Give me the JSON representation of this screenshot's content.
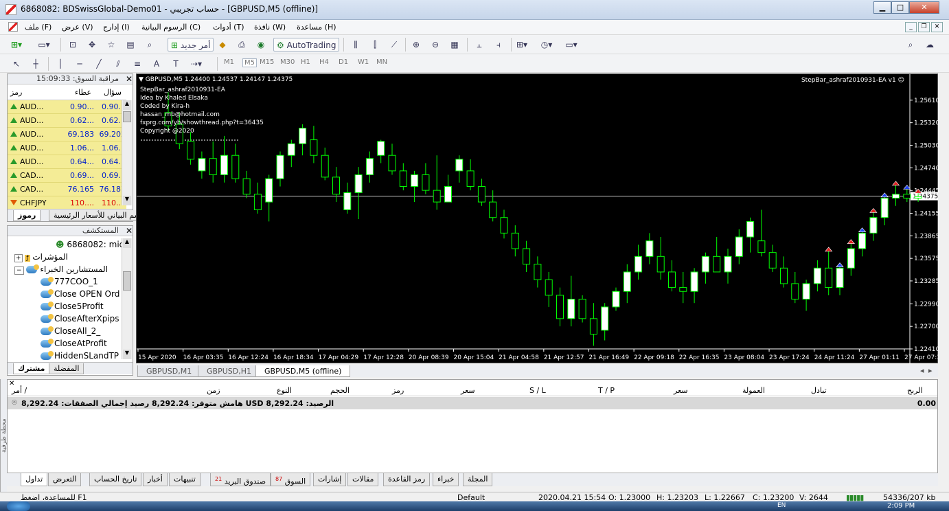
{
  "window": {
    "title": "6868082: BDSwissGlobal-Demo01 - حساب تجريبي - [GBPUSD,M5 (offline)]",
    "min": "▁",
    "max": "□",
    "close": "✕"
  },
  "menu": {
    "items": [
      "ملف (F)",
      "عرض (V)",
      "إدارج (I)",
      "الرسوم البيانية (C)",
      "أدوات (T)",
      "نافذة (W)",
      "مساعدة (H)"
    ]
  },
  "toolbar": {
    "new_order": "أمر جديد",
    "autotrading": "AutoTrading",
    "timeframes": [
      "M1",
      "M5",
      "M15",
      "M30",
      "H1",
      "H4",
      "D1",
      "W1",
      "MN"
    ],
    "text_tool": "A"
  },
  "market_watch": {
    "title": "مراقبة السوق: 15:09:33",
    "col_symbol": "رمز",
    "col_bid": "عطاء",
    "col_ask": "سؤال",
    "rows": [
      {
        "symbol": "AUD...",
        "bid": "0.90...",
        "ask": "0.90...",
        "dir": "up"
      },
      {
        "symbol": "AUD...",
        "bid": "0.62...",
        "ask": "0.62...",
        "dir": "up"
      },
      {
        "symbol": "AUD...",
        "bid": "69.183",
        "ask": "69.202",
        "dir": "up"
      },
      {
        "symbol": "AUD...",
        "bid": "1.06...",
        "ask": "1.06...",
        "dir": "up"
      },
      {
        "symbol": "AUD...",
        "bid": "0.64...",
        "ask": "0.64...",
        "dir": "up"
      },
      {
        "symbol": "CAD...",
        "bid": "0.69...",
        "ask": "0.69...",
        "dir": "up"
      },
      {
        "symbol": "CAD...",
        "bid": "76.165",
        "ask": "76.187",
        "dir": "up"
      },
      {
        "symbol": "CHFJPY",
        "bid": "110....",
        "ask": "110....",
        "dir": "down"
      }
    ],
    "tab_symbols": "رموز",
    "tab_chart": "رسم البياني للأسعار الرئيسية"
  },
  "navigator": {
    "title": "المستكشف",
    "account": "6868082: mido",
    "indicators": "المؤشرات",
    "experts": "المستشارين الخبراء",
    "items": [
      "777COO_1",
      "Close OPEN Orde",
      "Close5Profit",
      "CloseAfterXpips E",
      "CloseAll_2_",
      "CloseAtProfit",
      "HiddenSLandTP"
    ],
    "tab_common": "مشترك",
    "tab_favorites": "المفضلة"
  },
  "chart": {
    "header": "GBPUSD,M5  1.24400 1.24537 1.24147 1.24375",
    "ea_label": "StepBar_ashraf2010931-EA v1",
    "info_lines": [
      "StepBar_ashraf2010931-EA",
      "Idea by Khaled Elsaka",
      "Coded by Kira-h",
      "hassan_mb@hotmail.com",
      "fxprg.com/yb/showthread.php?t=36435",
      "Copyright @2020"
    ],
    "current_price": "1.24375",
    "price_labels": [
      "1.25610",
      "1.25320",
      "1.25030",
      "1.24740",
      "1.24445",
      "1.24155",
      "1.23865",
      "1.23575",
      "1.23285",
      "1.22990",
      "1.22700",
      "1.22410"
    ],
    "time_labels": [
      "15 Apr 2020",
      "16 Apr 03:35",
      "16 Apr 12:24",
      "16 Apr 18:34",
      "17 Apr 04:29",
      "17 Apr 12:28",
      "20 Apr 08:39",
      "20 Apr 15:04",
      "21 Apr 04:58",
      "21 Apr 12:57",
      "21 Apr 16:49",
      "22 Apr 09:18",
      "22 Apr 16:35",
      "23 Apr 08:04",
      "23 Apr 17:24",
      "24 Apr 11:24",
      "27 Apr 01:11",
      "27 Apr 07:35"
    ],
    "colors": {
      "bg": "#000000",
      "bull_body": "#ffffff",
      "bear_body": "#000000",
      "wick": "#00ff00",
      "text": "#ffffff"
    }
  },
  "chart_data": {
    "type": "candlestick",
    "symbol": "GBPUSD",
    "timeframe": "M5",
    "ylim": [
      1.2241,
      1.2575
    ],
    "candles": [
      {
        "o": 1.2545,
        "h": 1.2571,
        "l": 1.2522,
        "c": 1.2528
      },
      {
        "o": 1.253,
        "h": 1.2545,
        "l": 1.2498,
        "c": 1.2505
      },
      {
        "o": 1.2508,
        "h": 1.252,
        "l": 1.2478,
        "c": 1.2485
      },
      {
        "o": 1.247,
        "h": 1.2495,
        "l": 1.246,
        "c": 1.2486
      },
      {
        "o": 1.2486,
        "h": 1.2508,
        "l": 1.2455,
        "c": 1.2465
      },
      {
        "o": 1.2465,
        "h": 1.2515,
        "l": 1.2455,
        "c": 1.249
      },
      {
        "o": 1.249,
        "h": 1.2505,
        "l": 1.2455,
        "c": 1.246
      },
      {
        "o": 1.246,
        "h": 1.247,
        "l": 1.2435,
        "c": 1.244
      },
      {
        "o": 1.244,
        "h": 1.2455,
        "l": 1.2415,
        "c": 1.242
      },
      {
        "o": 1.243,
        "h": 1.2465,
        "l": 1.2405,
        "c": 1.246
      },
      {
        "o": 1.246,
        "h": 1.2495,
        "l": 1.245,
        "c": 1.249
      },
      {
        "o": 1.249,
        "h": 1.251,
        "l": 1.2475,
        "c": 1.2505
      },
      {
        "o": 1.2505,
        "h": 1.253,
        "l": 1.249,
        "c": 1.2525
      },
      {
        "o": 1.251,
        "h": 1.2528,
        "l": 1.248,
        "c": 1.249
      },
      {
        "o": 1.249,
        "h": 1.25,
        "l": 1.2458,
        "c": 1.2462
      },
      {
        "o": 1.2462,
        "h": 1.2475,
        "l": 1.243,
        "c": 1.244
      },
      {
        "o": 1.242,
        "h": 1.2455,
        "l": 1.2415,
        "c": 1.2442
      },
      {
        "o": 1.2442,
        "h": 1.2475,
        "l": 1.2408,
        "c": 1.2465
      },
      {
        "o": 1.2465,
        "h": 1.2495,
        "l": 1.2455,
        "c": 1.2486
      },
      {
        "o": 1.249,
        "h": 1.251,
        "l": 1.248,
        "c": 1.2508
      },
      {
        "o": 1.249,
        "h": 1.2505,
        "l": 1.2465,
        "c": 1.247
      },
      {
        "o": 1.247,
        "h": 1.248,
        "l": 1.2445,
        "c": 1.245
      },
      {
        "o": 1.245,
        "h": 1.247,
        "l": 1.243,
        "c": 1.2465
      },
      {
        "o": 1.2465,
        "h": 1.248,
        "l": 1.244,
        "c": 1.2445
      },
      {
        "o": 1.2445,
        "h": 1.249,
        "l": 1.242,
        "c": 1.243
      },
      {
        "o": 1.243,
        "h": 1.2465,
        "l": 1.244,
        "c": 1.245
      },
      {
        "o": 1.247,
        "h": 1.249,
        "l": 1.2455,
        "c": 1.2485
      },
      {
        "o": 1.247,
        "h": 1.2485,
        "l": 1.2445,
        "c": 1.245
      },
      {
        "o": 1.245,
        "h": 1.246,
        "l": 1.2425,
        "c": 1.243
      },
      {
        "o": 1.243,
        "h": 1.2445,
        "l": 1.2405,
        "c": 1.241
      },
      {
        "o": 1.241,
        "h": 1.242,
        "l": 1.2383,
        "c": 1.239
      },
      {
        "o": 1.239,
        "h": 1.24,
        "l": 1.236,
        "c": 1.237
      },
      {
        "o": 1.237,
        "h": 1.238,
        "l": 1.234,
        "c": 1.235
      },
      {
        "o": 1.235,
        "h": 1.236,
        "l": 1.232,
        "c": 1.233
      },
      {
        "o": 1.233,
        "h": 1.234,
        "l": 1.2295,
        "c": 1.231
      },
      {
        "o": 1.231,
        "h": 1.232,
        "l": 1.227,
        "c": 1.228
      },
      {
        "o": 1.228,
        "h": 1.2335,
        "l": 1.227,
        "c": 1.2305
      },
      {
        "o": 1.2305,
        "h": 1.231,
        "l": 1.2275,
        "c": 1.228
      },
      {
        "o": 1.228,
        "h": 1.23,
        "l": 1.2245,
        "c": 1.226
      },
      {
        "o": 1.2265,
        "h": 1.23,
        "l": 1.2252,
        "c": 1.2295
      },
      {
        "o": 1.2295,
        "h": 1.232,
        "l": 1.229,
        "c": 1.2315
      },
      {
        "o": 1.2315,
        "h": 1.235,
        "l": 1.23,
        "c": 1.234
      },
      {
        "o": 1.234,
        "h": 1.2375,
        "l": 1.233,
        "c": 1.236
      },
      {
        "o": 1.236,
        "h": 1.239,
        "l": 1.235,
        "c": 1.238
      },
      {
        "o": 1.236,
        "h": 1.2385,
        "l": 1.233,
        "c": 1.234
      },
      {
        "o": 1.234,
        "h": 1.2355,
        "l": 1.2315,
        "c": 1.232
      },
      {
        "o": 1.232,
        "h": 1.234,
        "l": 1.23,
        "c": 1.2315
      },
      {
        "o": 1.2315,
        "h": 1.2345,
        "l": 1.23,
        "c": 1.234
      },
      {
        "o": 1.234,
        "h": 1.2365,
        "l": 1.2325,
        "c": 1.236
      },
      {
        "o": 1.236,
        "h": 1.2385,
        "l": 1.235,
        "c": 1.234
      },
      {
        "o": 1.234,
        "h": 1.237,
        "l": 1.2325,
        "c": 1.236
      },
      {
        "o": 1.236,
        "h": 1.2395,
        "l": 1.235,
        "c": 1.2385
      },
      {
        "o": 1.2385,
        "h": 1.241,
        "l": 1.2365,
        "c": 1.2405
      },
      {
        "o": 1.238,
        "h": 1.242,
        "l": 1.236,
        "c": 1.2365
      },
      {
        "o": 1.2365,
        "h": 1.2375,
        "l": 1.234,
        "c": 1.2345
      },
      {
        "o": 1.2345,
        "h": 1.236,
        "l": 1.232,
        "c": 1.2325
      },
      {
        "o": 1.2325,
        "h": 1.234,
        "l": 1.23,
        "c": 1.2305
      },
      {
        "o": 1.2305,
        "h": 1.233,
        "l": 1.229,
        "c": 1.2325
      },
      {
        "o": 1.2325,
        "h": 1.2355,
        "l": 1.2315,
        "c": 1.2345
      },
      {
        "o": 1.2345,
        "h": 1.237,
        "l": 1.231,
        "c": 1.232
      },
      {
        "o": 1.232,
        "h": 1.235,
        "l": 1.231,
        "c": 1.2345
      },
      {
        "o": 1.2345,
        "h": 1.238,
        "l": 1.2335,
        "c": 1.237
      },
      {
        "o": 1.237,
        "h": 1.2395,
        "l": 1.236,
        "c": 1.239
      },
      {
        "o": 1.239,
        "h": 1.242,
        "l": 1.238,
        "c": 1.241
      },
      {
        "o": 1.241,
        "h": 1.244,
        "l": 1.24,
        "c": 1.2435
      },
      {
        "o": 1.2435,
        "h": 1.2455,
        "l": 1.2425,
        "c": 1.244
      },
      {
        "o": 1.244,
        "h": 1.245,
        "l": 1.243,
        "c": 1.2435
      },
      {
        "o": 1.2435,
        "h": 1.2445,
        "l": 1.243,
        "c": 1.2437
      }
    ]
  },
  "chart_tabs": [
    "GBPUSD,M1",
    "GBPUSD,H1",
    "GBPUSD,M5 (offline)"
  ],
  "terminal": {
    "columns": [
      "أمر /",
      "زمن",
      "النوع",
      "الحجم",
      "رمز",
      "سعر",
      "S / L",
      "T / P",
      "سعر",
      "العمولة",
      "تبادل",
      "الربح"
    ],
    "balance_text": "الرصيد: 8,292.24 USD  هامش متوفر: 8,292.24  رصيد إجمالي الصفقات: 8,292.24",
    "profit": "0.00",
    "side_label": "محطة طرفية",
    "tabs": [
      {
        "label": "تداول",
        "badge": ""
      },
      {
        "label": "التعرض",
        "badge": ""
      },
      {
        "label": "تاريخ الحساب",
        "badge": ""
      },
      {
        "label": "أخبار",
        "badge": ""
      },
      {
        "label": "تنبيهات",
        "badge": ""
      },
      {
        "label": "صندوق البريد",
        "badge": "21"
      },
      {
        "label": "السوق",
        "badge": "87"
      },
      {
        "label": "إشارات",
        "badge": ""
      },
      {
        "label": "مقالات",
        "badge": ""
      },
      {
        "label": "رمز القاعدة",
        "badge": ""
      },
      {
        "label": "خبراء",
        "badge": ""
      },
      {
        "label": "المجلة",
        "badge": ""
      }
    ]
  },
  "status": {
    "help": "للمساعدة، اضغط F1",
    "profile": "Default",
    "datetime": "2020.04.21 15:54",
    "open": "O: 1.23000",
    "high": "H: 1.23203",
    "low": "L: 1.22667",
    "close": "C: 1.23200",
    "volume": "V: 2644",
    "traffic": "54336/207 kb"
  },
  "taskbar": {
    "lang": "EN",
    "clock": "2:09 PM"
  }
}
